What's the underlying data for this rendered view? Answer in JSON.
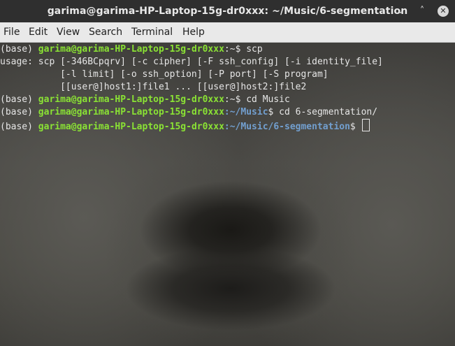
{
  "window": {
    "title": "garima@garima-HP-Laptop-15g-dr0xxx: ~/Music/6-segmentation",
    "controls": {
      "minimize": "⌄",
      "maximize": "˄",
      "close": "✕"
    }
  },
  "menu": {
    "file": "File",
    "edit": "Edit",
    "view": "View",
    "search": "Search",
    "terminal": "Terminal",
    "help": "Help"
  },
  "terminal": {
    "colors": {
      "prompt": "#8ae234",
      "path": "#729fcf",
      "text": "#e6e6e6"
    },
    "lines": [
      {
        "env": "(base) ",
        "userhost": "garima@garima-HP-Laptop-15g-dr0xxx",
        "path": ":~",
        "cmd": "$ scp"
      },
      {
        "text": "usage: scp [-346BCpqrv] [-c cipher] [-F ssh_config] [-i identity_file]"
      },
      {
        "text": "           [-l limit] [-o ssh_option] [-P port] [-S program]"
      },
      {
        "text": "           [[user@]host1:]file1 ... [[user@]host2:]file2"
      },
      {
        "env": "(base) ",
        "userhost": "garima@garima-HP-Laptop-15g-dr0xxx",
        "path": ":~",
        "cmd": "$ cd Music"
      },
      {
        "env": "(base) ",
        "userhost": "garima@garima-HP-Laptop-15g-dr0xxx",
        "path": ":~/Music",
        "cmd": "$ cd 6-segmentation/"
      },
      {
        "env": "(base) ",
        "userhost": "garima@garima-HP-Laptop-15g-dr0xxx",
        "path": ":~/Music/6-segmentation",
        "cmd": "$ "
      }
    ]
  }
}
